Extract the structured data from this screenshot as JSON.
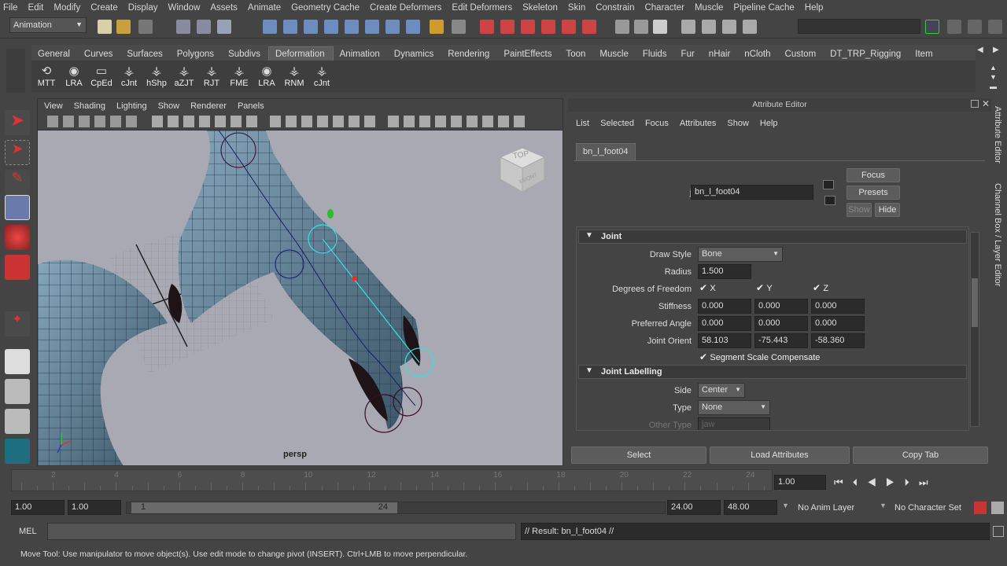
{
  "menus": [
    "File",
    "Edit",
    "Modify",
    "Create",
    "Display",
    "Window",
    "Assets",
    "Animate",
    "Geometry Cache",
    "Create Deformers",
    "Edit Deformers",
    "Skeleton",
    "Skin",
    "Constrain",
    "Character",
    "Muscle",
    "Pipeline Cache",
    "Help"
  ],
  "toolbar": {
    "mode_value": "Animation"
  },
  "shelf_tabs": [
    "General",
    "Curves",
    "Surfaces",
    "Polygons",
    "Subdivs",
    "Deformation",
    "Animation",
    "Dynamics",
    "Rendering",
    "PaintEffects",
    "Toon",
    "Muscle",
    "Fluids",
    "Fur",
    "nHair",
    "nCloth",
    "Custom",
    "DT_TRP_Rigging",
    "Item"
  ],
  "shelf_active": "Deformation",
  "shelf_buttons": [
    "MTT",
    "LRA",
    "CpEd",
    "cJnt",
    "hShp",
    "aZJT",
    "RJT",
    "FME",
    "LRA",
    "RNM",
    "cJnt"
  ],
  "viewport": {
    "menus": [
      "View",
      "Shading",
      "Lighting",
      "Show",
      "Renderer",
      "Panels"
    ],
    "camera_label": "persp",
    "viewcube_top": "TOP",
    "viewcube_front": "FRONT"
  },
  "attribute_editor": {
    "title": "Attribute Editor",
    "menus": [
      "List",
      "Selected",
      "Focus",
      "Attributes",
      "Show",
      "Help"
    ],
    "node_tab": "bn_l_foot04",
    "joint_label": "joint:",
    "joint_value": "bn_l_foot04",
    "buttons": {
      "focus": "Focus",
      "presets": "Presets",
      "show": "Show",
      "hide": "Hide"
    },
    "joint_section": "Joint",
    "draw_style_label": "Draw Style",
    "draw_style_value": "Bone",
    "radius_label": "Radius",
    "radius_value": "1.500",
    "dof_label": "Degrees of Freedom",
    "dof_x": "X",
    "dof_y": "Y",
    "dof_z": "Z",
    "stiffness_label": "Stiffness",
    "stiffness": [
      "0.000",
      "0.000",
      "0.000"
    ],
    "preferred_label": "Preferred Angle",
    "preferred": [
      "0.000",
      "0.000",
      "0.000"
    ],
    "orient_label": "Joint Orient",
    "orient": [
      "58.103",
      "-75.443",
      "-58.360"
    ],
    "segment_label": "Segment Scale Compensate",
    "labelling_section": "Joint Labelling",
    "side_label": "Side",
    "side_value": "Center",
    "type_label": "Type",
    "type_value": "None",
    "other_type_label": "Other Type",
    "other_type_value": "jaw",
    "bottom_buttons": {
      "select": "Select",
      "load": "Load Attributes",
      "copy": "Copy Tab"
    }
  },
  "side_tabs": {
    "ae": "Attribute Editor",
    "cb": "Channel Box / Layer Editor"
  },
  "timeline": {
    "ticks": [
      "2",
      "4",
      "6",
      "8",
      "10",
      "12",
      "14",
      "16",
      "18",
      "20",
      "22",
      "24"
    ],
    "current_frame": "1.00"
  },
  "range": {
    "start": "1.00",
    "playback_start": "1.00",
    "slider_start": "1",
    "slider_end": "24",
    "playback_end": "24.00",
    "end": "48.00",
    "anim_layer": "No Anim Layer",
    "char_set": "No Character Set"
  },
  "command": {
    "mel_label": "MEL",
    "result": "// Result: bn_l_foot04 //"
  },
  "help_line": "Move Tool: Use manipulator to move object(s). Use edit mode to change pivot (INSERT).  Ctrl+LMB to move perpendicular."
}
